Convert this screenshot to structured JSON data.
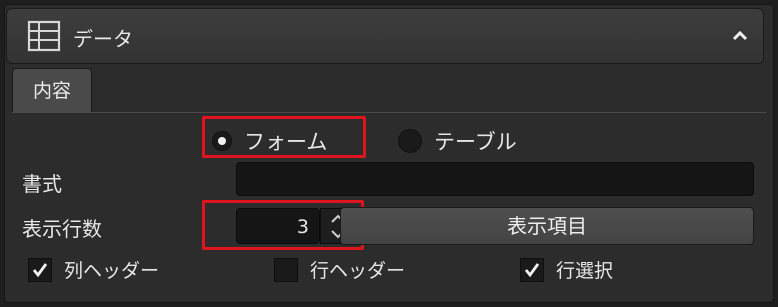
{
  "panel": {
    "title": "データ",
    "icon": "table-icon",
    "collapse_icon": "chevron-up-icon"
  },
  "tabs": [
    {
      "label": "内容",
      "active": true
    }
  ],
  "layout_mode": {
    "options": [
      {
        "label": "フォーム",
        "selected": true
      },
      {
        "label": "テーブル",
        "selected": false
      }
    ]
  },
  "format": {
    "label": "書式",
    "value": ""
  },
  "rows": {
    "label": "表示行数",
    "value": "3"
  },
  "display_items_button": "表示項目",
  "checkboxes": [
    {
      "label": "列ヘッダー",
      "checked": true
    },
    {
      "label": "行ヘッダー",
      "checked": false
    },
    {
      "label": "行選択",
      "checked": true
    }
  ],
  "colors": {
    "highlight": "#e0141e",
    "panel_bg": "#2c2c2c",
    "field_bg": "#151515"
  }
}
